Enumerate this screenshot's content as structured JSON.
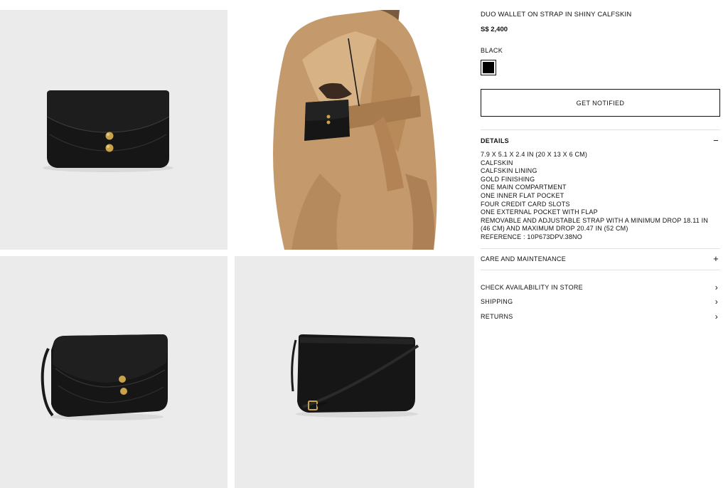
{
  "product": {
    "title": "DUO WALLET ON STRAP IN SHINY CALFSKIN",
    "price": "S$ 2,400",
    "color_label": "BLACK",
    "swatch_color": "#000000",
    "notify_label": "GET NOTIFIED"
  },
  "details": {
    "label": "DETAILS",
    "toggle": "−",
    "items": [
      "7.9 X 5.1 X 2.4 IN (20 X 13 X 6 CM)",
      "CALFSKIN",
      "CALFSKIN LINING",
      "GOLD FINISHING",
      "ONE MAIN COMPARTMENT",
      "ONE INNER FLAT POCKET",
      "FOUR CREDIT CARD SLOTS",
      "ONE EXTERNAL POCKET WITH FLAP",
      "REMOVABLE AND ADJUSTABLE STRAP WITH A MINIMUM DROP 18.11 IN (46 CM) AND MAXIMUM DROP 20.47 IN (52 CM)",
      "REFERENCE : 10P673DPV.38NO"
    ]
  },
  "care": {
    "label": "CARE AND MAINTENANCE",
    "toggle": "+"
  },
  "links": {
    "availability": "CHECK AVAILABILITY IN STORE",
    "shipping": "SHIPPING",
    "returns": "RETURNS",
    "chevron": "›"
  },
  "colors": {
    "tile_bg": "#ebebeb",
    "bag": "#141414",
    "gold": "#c9a24a",
    "coat": "#c9a57a"
  }
}
